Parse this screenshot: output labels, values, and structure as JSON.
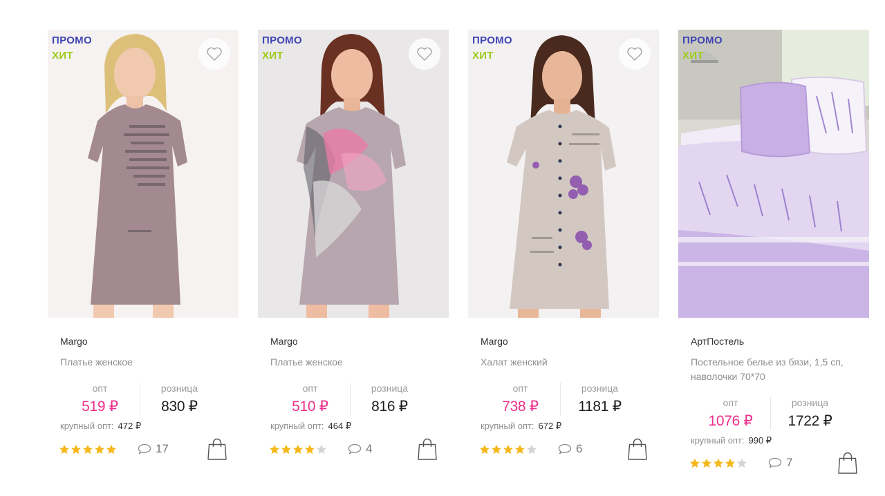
{
  "labels": {
    "opt": "опт",
    "retail": "розница",
    "bulk": "крупный опт:"
  },
  "colors": {
    "promo": "#3f44b4",
    "hit": "#9ccc1c",
    "opt_price": "#ef2f8c",
    "star": "#f5b81c",
    "star_empty": "#d4d4d4"
  },
  "icons": {
    "favorite": "heart-icon",
    "comments": "speech-bubble-icon",
    "cart": "shopping-bag-icon",
    "rating": "star-icon"
  },
  "products": [
    {
      "badges": [
        "ПРОМО",
        "ХИТ"
      ],
      "brand": "Margo",
      "name": "Платье женское",
      "opt_price": "519 ₽",
      "retail_price": "830 ₽",
      "bulk_price": "472 ₽",
      "rating": 5,
      "comments": "17"
    },
    {
      "badges": [
        "ПРОМО",
        "ХИТ"
      ],
      "brand": "Margo",
      "name": "Платье женское",
      "opt_price": "510 ₽",
      "retail_price": "816 ₽",
      "bulk_price": "464 ₽",
      "rating": 4,
      "comments": "4"
    },
    {
      "badges": [
        "ПРОМО",
        "ХИТ"
      ],
      "brand": "Margo",
      "name": "Халат женский",
      "opt_price": "738 ₽",
      "retail_price": "1181 ₽",
      "bulk_price": "672 ₽",
      "rating": 4,
      "comments": "6"
    },
    {
      "badges": [
        "ПРОМО",
        "ХИТ"
      ],
      "brand": "АртПостель",
      "name": "Постельное белье из бязи, 1,5 сп, наволочки 70*70",
      "opt_price": "1076 ₽",
      "retail_price": "1722 ₽",
      "bulk_price": "990 ₽",
      "rating": 4,
      "comments": "7"
    }
  ]
}
